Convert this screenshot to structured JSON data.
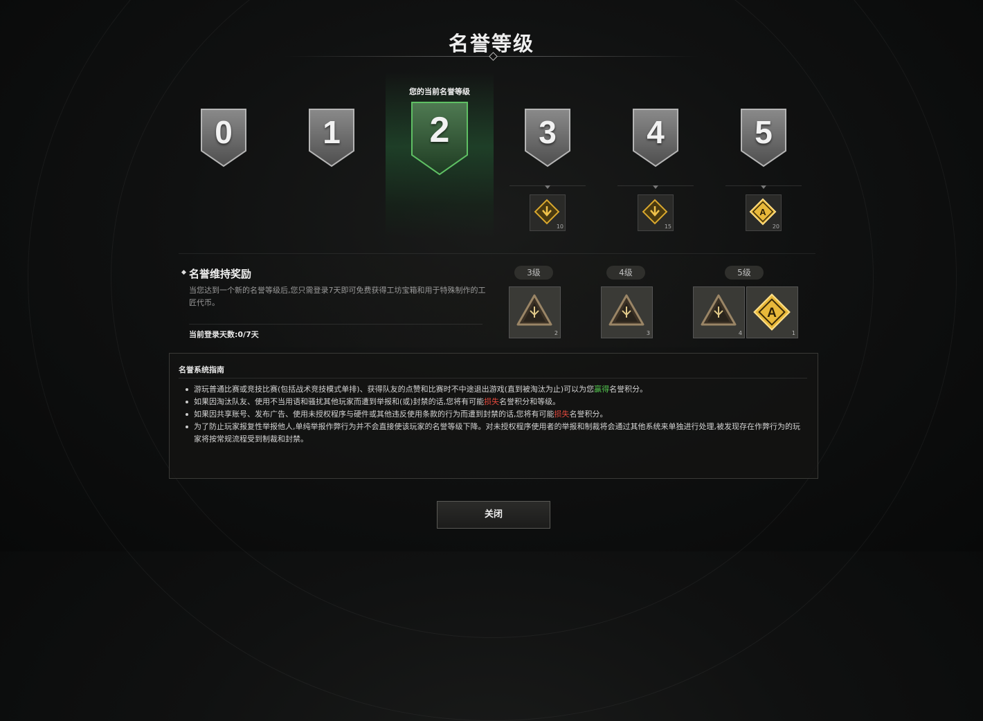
{
  "title": "名誉等级",
  "current_level_label": "您的当前名誉等级",
  "current_level": 2,
  "levels": [
    {
      "number": "0"
    },
    {
      "number": "1"
    },
    {
      "number": "2"
    },
    {
      "number": "3"
    },
    {
      "number": "4"
    },
    {
      "number": "5"
    }
  ],
  "level_rewards": [
    {
      "level": "3",
      "icon": "arrow-down-badge-icon",
      "count": "10"
    },
    {
      "level": "4",
      "icon": "arrow-down-badge-icon",
      "count": "15"
    },
    {
      "level": "5",
      "icon": "a-badge-icon",
      "count": "20"
    }
  ],
  "maintenance": {
    "title": "名誉维持奖励",
    "description": "当您达到一个新的名誉等级后,您只需登录7天即可免费获得工坊宝箱和用于特殊制作的工匠代币。",
    "login_days": "当前登录天数:0/7天",
    "tiers": [
      {
        "label": "3级",
        "items": [
          {
            "icon": "workshop-crate-icon",
            "count": "2"
          }
        ]
      },
      {
        "label": "4级",
        "items": [
          {
            "icon": "workshop-crate-icon",
            "count": "3"
          }
        ]
      },
      {
        "label": "5级",
        "items": [
          {
            "icon": "workshop-crate-icon",
            "count": "4"
          },
          {
            "icon": "artisan-token-icon",
            "count": "1"
          }
        ]
      }
    ]
  },
  "guide": {
    "title": "名誉系统指南",
    "items": [
      {
        "before": "游玩普通比赛或竞技比赛(包括战术竞技模式单排)、获得队友的点赞和比赛时不中途退出游戏(直到被淘汰为止)可以为您",
        "highlight": "赢得",
        "after": "名誉积分。",
        "tone": "green"
      },
      {
        "before": "如果因淘汰队友、使用不当用语和骚扰其他玩家而遭到举报和(或)封禁的话,您将有可能",
        "highlight": "损失",
        "after": "名誉积分和等级。",
        "tone": "red"
      },
      {
        "before": "如果因共享账号、发布广告、使用未授权程序与硬件或其他违反使用条款的行为而遭到封禁的话,您将有可能",
        "highlight": "损失",
        "after": "名誉积分。",
        "tone": "red"
      },
      {
        "before": "为了防止玩家报复性举报他人,单纯举报作弊行为并不会直接使该玩家的名誉等级下降。对未授权程序使用者的举报和制裁将会通过其他系统来单独进行处理,被发现存在作弊行为的玩家将按常规流程受到制裁和封禁。",
        "highlight": "",
        "after": "",
        "tone": "none"
      }
    ]
  },
  "close_label": "关闭",
  "colors": {
    "current_accent": "#3fa04a",
    "gain": "#52c24e",
    "loss": "#e2493d",
    "gold": "#e8b83a"
  }
}
